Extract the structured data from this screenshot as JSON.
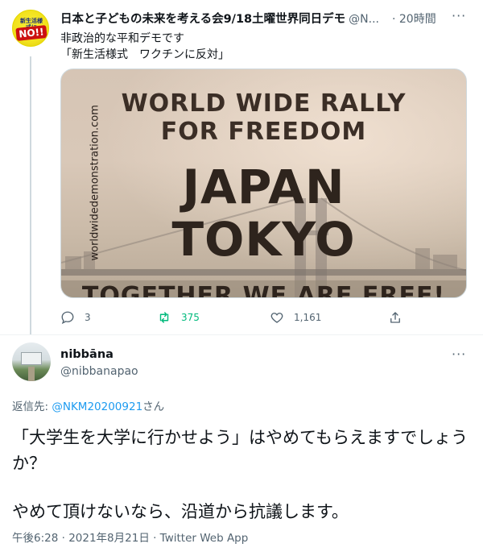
{
  "tweet1": {
    "avatar_text_top": "新生活様式に",
    "avatar_text_no": "NO!!",
    "display_name": "日本と子どもの未来を考える会9/18土曜世界同日デモ",
    "handle": "@N...",
    "time": "· 20時間",
    "more": "···",
    "lines": [
      "非政治的な平和デモです",
      "「新生活様式　ワクチンに反対」"
    ],
    "media": {
      "side_text": "worldwidedemonstration.com",
      "line1": "WORLD WIDE RALLY",
      "line2": "FOR FREEDOM",
      "big1": "JAPAN",
      "big2": "TOKYO",
      "bottom": "TOGETHER WE ARE FREE!"
    },
    "actions": {
      "reply_count": "3",
      "retweet_count": "375",
      "like_count": "1,161"
    }
  },
  "tweet2": {
    "display_name": "nibbāna",
    "handle": "@nibbanapao",
    "more": "···",
    "replying_prefix": "返信先: ",
    "replying_mention": "@NKM20200921",
    "replying_suffix": "さん",
    "paragraph1": "「大学生を大学に行かせよう」はやめてもらえますでしょうか？",
    "paragraph2": "やめて頂けないなら、沿道から抗議します。",
    "meta": "午後6:28 · 2021年8月21日 · Twitter Web App"
  },
  "colors": {
    "text": "#0f1419",
    "secondary": "#536471",
    "link": "#1d9bf0",
    "retweet_green": "#00ba7c"
  }
}
